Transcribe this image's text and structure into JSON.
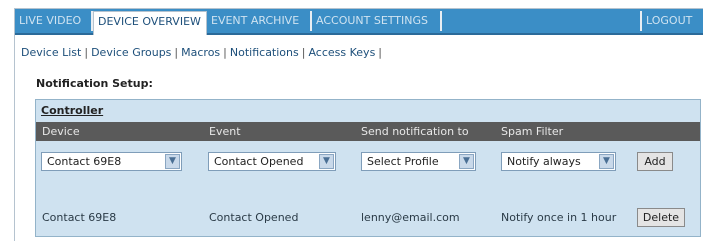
{
  "nav": {
    "tabs": [
      {
        "label": "LIVE VIDEO"
      },
      {
        "label": "DEVICE OVERVIEW"
      },
      {
        "label": "EVENT ARCHIVE"
      },
      {
        "label": "ACCOUNT SETTINGS"
      }
    ],
    "logout": "LOGOUT"
  },
  "subnav": {
    "items": [
      {
        "label": "Device List"
      },
      {
        "label": "Device Groups"
      },
      {
        "label": "Macros"
      },
      {
        "label": "Notifications"
      },
      {
        "label": "Access Keys"
      }
    ],
    "separator": "|"
  },
  "page_title": "Notification Setup:",
  "panel": {
    "heading": "Controller",
    "columns": [
      "Device",
      "Event",
      "Send notification to",
      "Spam Filter"
    ],
    "form": {
      "device": "Contact 69E8",
      "event": "Contact Opened",
      "profile": "Select Profile",
      "spam": "Notify always",
      "add_label": "Add"
    },
    "rows": [
      {
        "device": "Contact 69E8",
        "event": "Contact Opened",
        "recipient": "lenny@email.com",
        "spam": "Notify once in 1 hour",
        "delete_label": "Delete"
      }
    ]
  },
  "colors": {
    "tabbar": "#3b8ec6",
    "header_row": "#5a5a5a",
    "panel_bg": "#cfe2f0"
  }
}
